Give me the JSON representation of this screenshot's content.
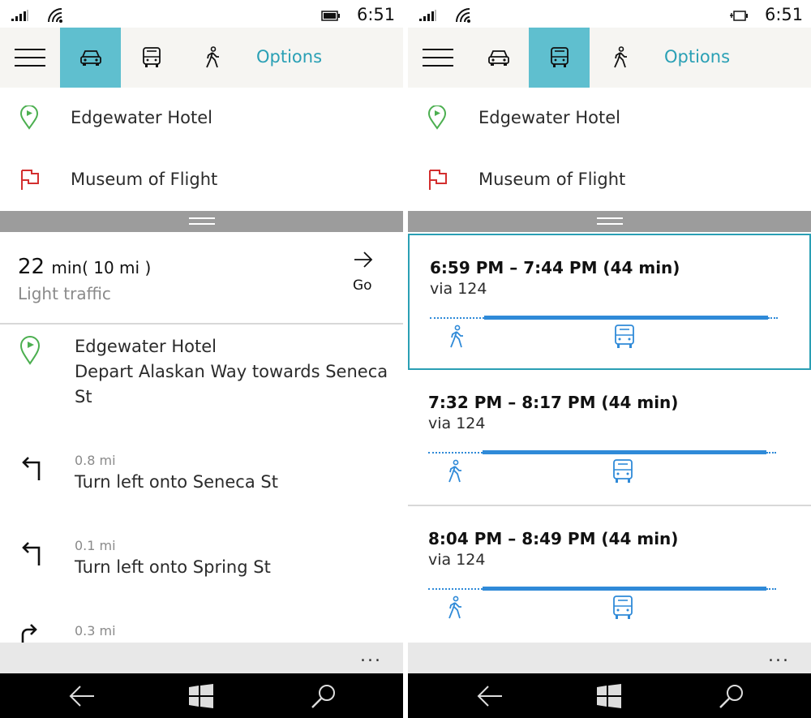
{
  "left": {
    "status": {
      "time": "6:51"
    },
    "appbar": {
      "options_label": "Options",
      "selected_mode": "car"
    },
    "from": {
      "label": "Edgewater Hotel"
    },
    "to": {
      "label": "Museum of Flight"
    },
    "summary": {
      "duration_value": "22",
      "duration_unit": "min",
      "distance": "( 10 mi )",
      "traffic": "Light traffic",
      "go_label": "Go"
    },
    "directions": [
      {
        "distance": "",
        "lines": [
          "Edgewater Hotel",
          "Depart Alaskan Way towards Seneca",
          "St"
        ],
        "icon": "start-pin-icon"
      },
      {
        "distance": "0.8 mi",
        "lines": [
          "Turn left onto Seneca St"
        ],
        "icon": "turn-left-icon"
      },
      {
        "distance": "0.1 mi",
        "lines": [
          "Turn left onto Spring St"
        ],
        "icon": "turn-left-icon"
      },
      {
        "distance": "0.3 mi",
        "lines": [],
        "icon": "turn-right-icon"
      }
    ],
    "more_label": "..."
  },
  "right": {
    "status": {
      "time": "6:51"
    },
    "appbar": {
      "options_label": "Options",
      "selected_mode": "transit"
    },
    "from": {
      "label": "Edgewater Hotel"
    },
    "to": {
      "label": "Museum of Flight"
    },
    "trips": [
      {
        "times": "6:59 PM – 7:44 PM (44 min)",
        "via": "via 124",
        "selected": true
      },
      {
        "times": "7:32 PM – 8:17 PM (44 min)",
        "via": "via 124",
        "selected": false
      },
      {
        "times": "8:04 PM – 8:49 PM (44 min)",
        "via": "via 124",
        "selected": false
      }
    ],
    "more_label": "..."
  },
  "colors": {
    "accent": "#5fbfcf",
    "link": "#2aa0b5",
    "route_line": "#2f8ad8",
    "origin_pin": "#4caf50",
    "destination_flag": "#d32f2f"
  }
}
